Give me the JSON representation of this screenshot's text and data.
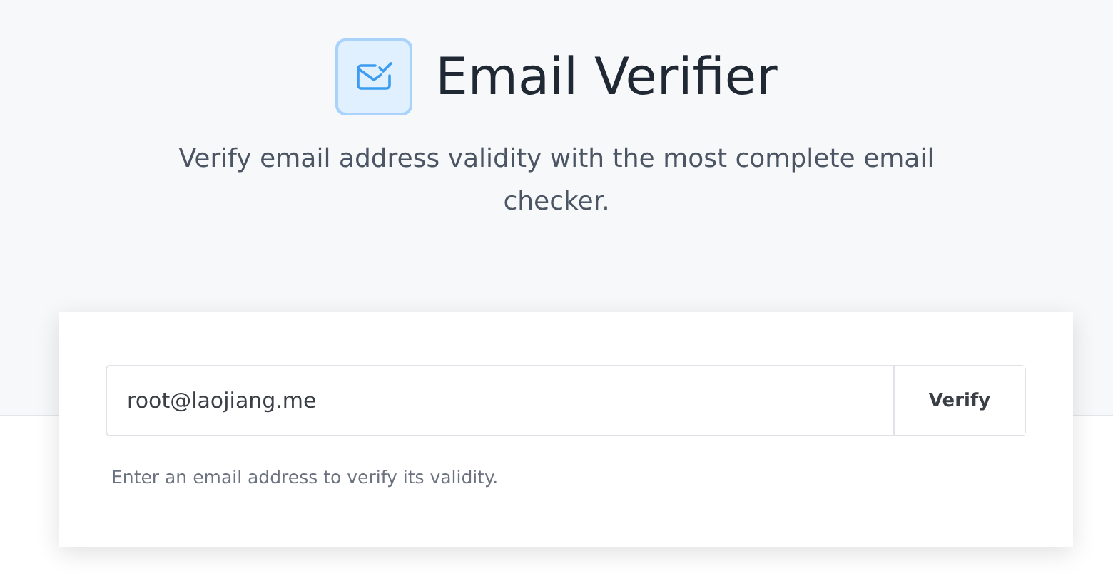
{
  "header": {
    "title": "Email Verifier",
    "subtitle": "Verify email address validity with the most complete email checker."
  },
  "form": {
    "value": "root@laojiang.me",
    "button": "Verify",
    "help": "Enter an email address to verify its validity."
  }
}
